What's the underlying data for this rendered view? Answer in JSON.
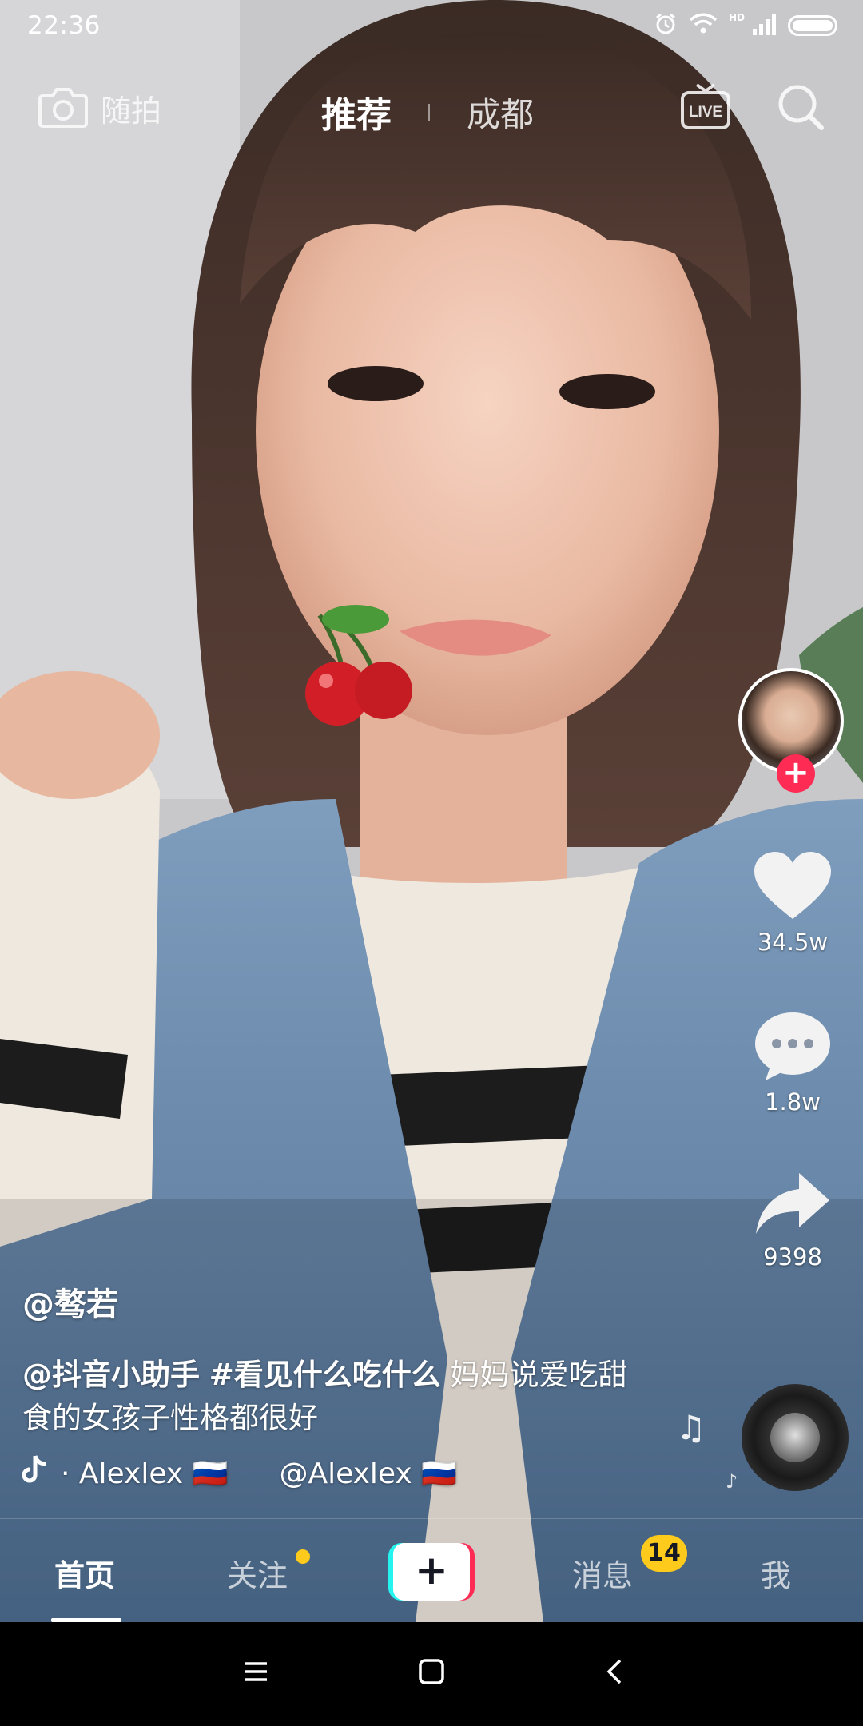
{
  "status_bar": {
    "time": "22:36",
    "hd": "HD",
    "icons": [
      "alarm-icon",
      "wifi-icon",
      "signal-icon",
      "battery-icon"
    ]
  },
  "top_nav": {
    "snap_label": "随拍",
    "tabs": [
      {
        "label": "推荐",
        "active": true
      },
      {
        "label": "成都",
        "active": false
      }
    ],
    "live_label": "LIVE",
    "icons": [
      "camera-icon",
      "live-tv-icon",
      "search-icon"
    ]
  },
  "side_actions": {
    "follow_symbol": "+",
    "like_count": "34.5w",
    "comment_count": "1.8w",
    "share_count": "9398"
  },
  "caption": {
    "author": "@骜若",
    "mention": "@抖音小助手",
    "hashtag": "#看见什么吃什么",
    "text": " 妈妈说爱吃甜食的女孩子性格都很好"
  },
  "music": {
    "first": "· Alexlex 🇷🇺",
    "second": "@Alexlex 🇷🇺"
  },
  "tab_bar": {
    "home": "首页",
    "follow": "关注",
    "create_symbol": "+",
    "messages": "消息",
    "messages_badge": "14",
    "me": "我"
  },
  "colors": {
    "accent_red": "#fe2c55",
    "accent_cyan": "#25f4ee",
    "badge_yellow": "#fecb1d"
  }
}
